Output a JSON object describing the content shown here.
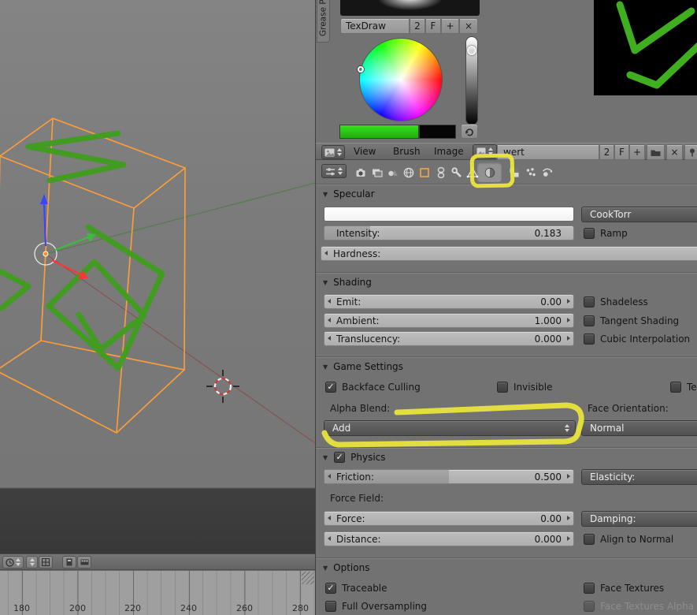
{
  "glyphs": {
    "check": "✓",
    "panel_arrow": "▼",
    "close": "×",
    "plus": "+"
  },
  "grease_panel": {
    "tab_label": "Grease Pe",
    "brush_name": "TexDraw",
    "users_count": "2",
    "fake_user_label": "F"
  },
  "image_editor": {
    "menu_view": "View",
    "menu_brush": "Brush",
    "menu_image": "Image",
    "datablock_name": "wert",
    "users_count": "2",
    "fake_user_label": "F"
  },
  "properties_tabs": {
    "icons": [
      "render-icon",
      "render-layers-icon",
      "scene-icon",
      "world-icon",
      "object-icon",
      "constraints-icon",
      "modifiers-icon",
      "object-data-icon",
      "material-icon",
      "texture-icon",
      "particles-icon",
      "physics-icon"
    ],
    "active_tab": "material"
  },
  "specular": {
    "title": "Specular",
    "shader_model": "CookTorr",
    "ramp_label": "Ramp",
    "intensity_label": "Intensity:",
    "intensity_value": "0.183",
    "hardness_label": "Hardness:"
  },
  "shading": {
    "title": "Shading",
    "emit_label": "Emit:",
    "emit_value": "0.00",
    "ambient_label": "Ambient:",
    "ambient_value": "1.000",
    "translucency_label": "Translucency:",
    "translucency_value": "0.000",
    "shadeless_label": "Shadeless",
    "tangent_label": "Tangent Shading",
    "cubic_label": "Cubic Interpolation"
  },
  "game_settings": {
    "title": "Game Settings",
    "backface_label": "Backface Culling",
    "invisible_label": "Invisible",
    "text_label_partial": "Te",
    "alpha_blend_label": "Alpha Blend:",
    "alpha_blend_value": "Add",
    "face_orientation_label": "Face Orientation:",
    "face_orientation_value": "Normal"
  },
  "physics": {
    "title": "Physics",
    "friction_label": "Friction:",
    "friction_value": "0.500",
    "elasticity_label": "Elasticity:",
    "force_field_label": "Force Field:",
    "force_label": "Force:",
    "force_value": "0.00",
    "damping_label": "Damping:",
    "distance_label": "Distance:",
    "distance_value": "0.000",
    "align_label": "Align to Normal"
  },
  "options": {
    "title": "Options",
    "traceable_label": "Traceable",
    "full_oversampling_label": "Full Oversampling",
    "face_textures_label": "Face Textures",
    "face_textures_alpha_label": "Face Textures Alpha"
  },
  "timeline": {
    "ruler_labels": [
      "180",
      "200",
      "220",
      "240",
      "260",
      "280"
    ]
  },
  "colors": {
    "selected_object_orange": "#ff9e37",
    "grease_green": "#3f9e1d",
    "annotation_yellow": "#ece63c",
    "brush_color_green": "#2bd30e",
    "widget_dark": "#565656",
    "panel_bg": "#727272"
  }
}
